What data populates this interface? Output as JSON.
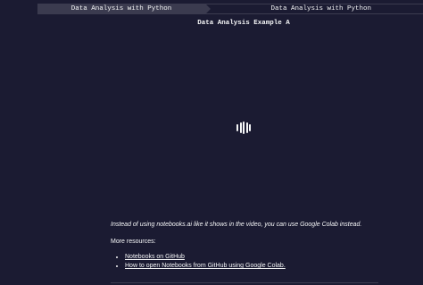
{
  "breadcrumb": {
    "first": "Data Analysis with Python",
    "second": "Data Analysis with Python"
  },
  "page": {
    "title": "Data Analysis Example A"
  },
  "video": {
    "loader_icon": "loading-bars-icon"
  },
  "content": {
    "note": "Instead of using notebooks.ai like it shows in the video, you can use Google Colab instead.",
    "resources_heading": "More resources:",
    "links": [
      {
        "label": "Notebooks on GitHub"
      },
      {
        "label": "How to open Notebooks from GitHub using Google Colab."
      }
    ]
  },
  "colors": {
    "background": "#1b1b32",
    "crumb_bg": "#3b3b4f",
    "text": "#f5f6f7"
  }
}
